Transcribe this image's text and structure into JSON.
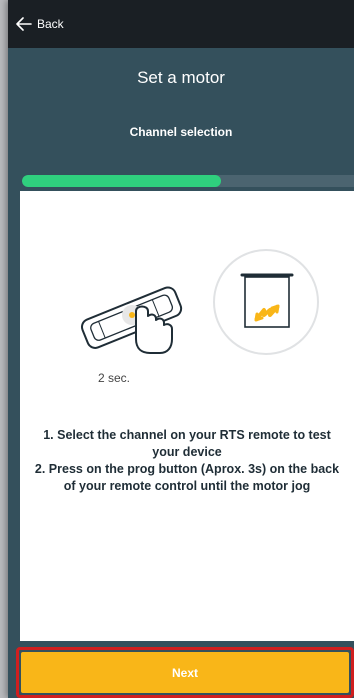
{
  "header": {
    "back_label": "Back",
    "back_icon": "arrow-left-icon"
  },
  "page": {
    "title": "Set a motor",
    "subtitle": "Channel selection"
  },
  "progress": {
    "value": 0.6,
    "fill_color": "#2fd07e",
    "track_color": "#4b6470"
  },
  "illustration": {
    "remote_icon": "rts-remote-press-icon",
    "motor_icon": "motor-jog-icon",
    "hold_time": "2 sec."
  },
  "instructions": {
    "step1": "1. Select the channel on your RTS remote to test your device",
    "step2": "2. Press on the prog button (Aprox. 3s) on the back of your remote control until the motor jog"
  },
  "footer": {
    "next_label": "Next",
    "next_color": "#f9b618"
  },
  "colors": {
    "background": "#34505c",
    "topbar": "#1a1f24",
    "highlight_border": "#d01f1f"
  }
}
